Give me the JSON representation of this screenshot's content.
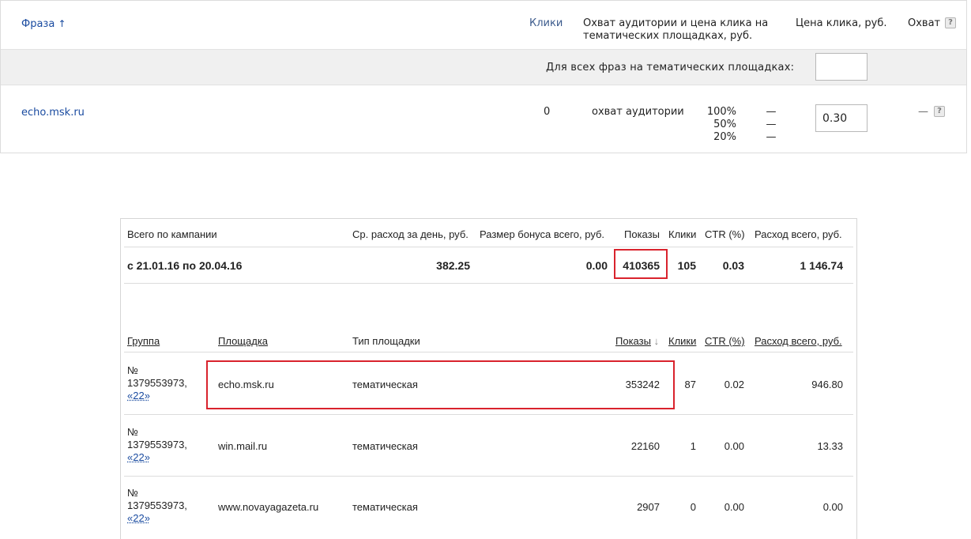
{
  "bid_table": {
    "headers": {
      "phrase": "Фраза",
      "phrase_sort_icon": "arrow-up-icon",
      "clicks": "Клики",
      "coverage_price_line1": "Охват аудитории и цена клика на",
      "coverage_price_line2": "тематических площадках, руб.",
      "click_price": "Цена клика, руб.",
      "coverage": "Охват"
    },
    "all_phrases_label": "Для всех фраз на тематических площадках:",
    "all_phrases_value": "",
    "row": {
      "phrase": "echo.msk.ru",
      "clicks": "0",
      "coverage_label": "охват аудитории",
      "coverage_levels": [
        "100%",
        "50%",
        "20%"
      ],
      "coverage_prices": [
        "—",
        "—",
        "—"
      ],
      "bid": "0.30",
      "coverage_value": "—"
    },
    "help_icon_text": "?"
  },
  "stats": {
    "summary_headers": {
      "campaign_total": "Всего по кампании",
      "avg_daily": "Ср. расход за день, руб.",
      "bonus": "Размер бонуса всего, руб.",
      "impressions": "Показы",
      "clicks": "Клики",
      "ctr": "CTR (%)",
      "total_spend": "Расход всего, руб."
    },
    "summary_row": {
      "period": "с 21.01.16 по 20.04.16",
      "avg_daily": "382.25",
      "bonus": "0.00",
      "impressions": "410365",
      "clicks": "105",
      "ctr": "0.03",
      "total_spend": "1 146.74"
    },
    "detail_headers": {
      "group": "Группа",
      "site": "Площадка",
      "site_type": "Тип площадки",
      "impressions": "Показы",
      "impressions_sort": "↓",
      "clicks": "Клики",
      "ctr": "CTR (%)",
      "total_spend": "Расход всего, руб."
    },
    "rows": [
      {
        "group_no": "№",
        "group_id": "1379553973,",
        "group_link": "«22»",
        "site": "echo.msk.ru",
        "site_type": "тематическая",
        "impressions": "353242",
        "clicks": "87",
        "ctr": "0.02",
        "spend": "946.80"
      },
      {
        "group_no": "№",
        "group_id": "1379553973,",
        "group_link": "«22»",
        "site": "win.mail.ru",
        "site_type": "тематическая",
        "impressions": "22160",
        "clicks": "1",
        "ctr": "0.00",
        "spend": "13.33"
      },
      {
        "group_no": "№",
        "group_id": "1379553973,",
        "group_link": "«22»",
        "site": "www.novayagazeta.ru",
        "site_type": "тематическая",
        "impressions": "2907",
        "clicks": "0",
        "ctr": "0.00",
        "spend": "0.00"
      }
    ]
  },
  "colors": {
    "highlight": "#d9232d",
    "link": "#1a4ba0",
    "band": "#f0f0f0"
  }
}
